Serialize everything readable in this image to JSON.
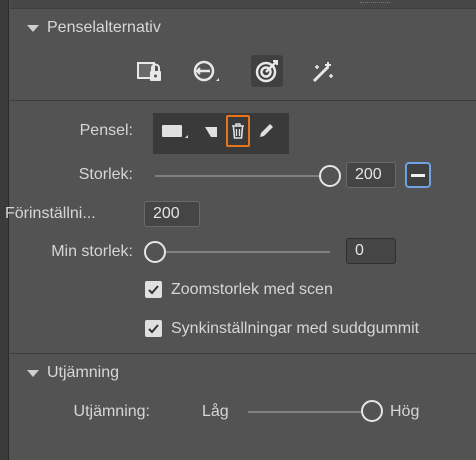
{
  "sections": {
    "brush_options": {
      "title": "Penselalternativ"
    },
    "smoothing": {
      "title": "Utjämning"
    }
  },
  "toolbar": {
    "icons": [
      "lock-icon",
      "transform-icon",
      "target-icon",
      "magic-wand-icon"
    ],
    "selected_index": 2
  },
  "brush": {
    "label": "Pensel:",
    "buttons": [
      "brush-shape-icon",
      "brush-corner-icon",
      "trash-icon",
      "pencil-icon"
    ],
    "highlighted": "trash-icon"
  },
  "size": {
    "label": "Storlek:",
    "value": "200",
    "slider_fraction": 1.0
  },
  "preset": {
    "label": "Förinställni...",
    "value": "200"
  },
  "min_size": {
    "label": "Min storlek:",
    "value": "0",
    "slider_fraction": 0.0
  },
  "checkboxes": {
    "zoom_size": {
      "label": "Zoomstorlek med scen",
      "checked": true
    },
    "sync_eraser": {
      "label": "Synkinställningar med suddgummit",
      "checked": true
    }
  },
  "smoothing": {
    "label": "Utjämning:",
    "low_label": "Låg",
    "high_label": "Hög",
    "slider_fraction": 1.0
  },
  "colors": {
    "panel_bg": "#535353",
    "highlight_orange": "#e8741c",
    "focus_blue": "#6fa2e3"
  }
}
